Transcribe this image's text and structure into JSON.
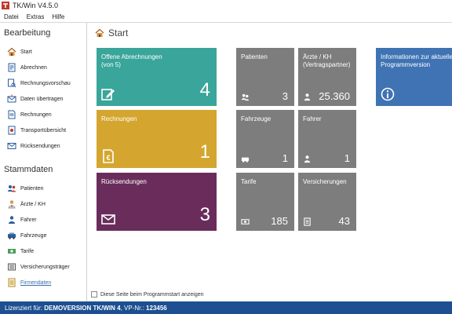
{
  "window": {
    "title": "TK/Win V4.5.0"
  },
  "menu": [
    "Datei",
    "Extras",
    "Hilfe"
  ],
  "sidebar": {
    "section_bearbeitung": "Bearbeitung",
    "bearbeitung_items": [
      {
        "label": "Start",
        "icon": "home-icon"
      },
      {
        "label": "Abrechnen",
        "icon": "invoice-icon"
      },
      {
        "label": "Rechnungsvorschau",
        "icon": "preview-icon"
      },
      {
        "label": "Daten übertragen",
        "icon": "transfer-icon"
      },
      {
        "label": "Rechnungen",
        "icon": "document-icon"
      },
      {
        "label": "Transportübersicht",
        "icon": "overview-icon"
      },
      {
        "label": "Rücksendungen",
        "icon": "mail-icon"
      }
    ],
    "section_stammdaten": "Stammdaten",
    "stammdaten_items": [
      {
        "label": "Patienten",
        "icon": "patients-icon"
      },
      {
        "label": "Ärzte / KH",
        "icon": "doctor-icon"
      },
      {
        "label": "Fahrer",
        "icon": "driver-icon"
      },
      {
        "label": "Fahrzeuge",
        "icon": "vehicle-icon"
      },
      {
        "label": "Tarife",
        "icon": "tariff-icon"
      },
      {
        "label": "Versicherungsträger",
        "icon": "insurance-icon"
      },
      {
        "label": "Firmendaten",
        "icon": "company-icon"
      }
    ]
  },
  "main": {
    "title": "Start",
    "tiles": {
      "offene": {
        "label": "Offene Abrechnungen\n(von 5)",
        "count": "4",
        "color": "#3aa59a"
      },
      "rechnungen": {
        "label": "Rechnungen",
        "count": "1",
        "color": "#d4a62f"
      },
      "ruecksendungen": {
        "label": "Rücksendungen",
        "count": "3",
        "color": "#6a2d5b"
      },
      "patienten": {
        "label": "Patienten",
        "count": "3"
      },
      "aerzte": {
        "label": "Ärzte / KH\n(Vertragspartner)",
        "count": "25.360"
      },
      "fahrzeuge": {
        "label": "Fahrzeuge",
        "count": "1"
      },
      "fahrer": {
        "label": "Fahrer",
        "count": "1"
      },
      "tarife": {
        "label": "Tarife",
        "count": "185"
      },
      "versicherungen": {
        "label": "Versicherungen",
        "count": "43"
      },
      "info": {
        "label": "Informationen zur aktuellen\nProgrammversion",
        "color": "#3f73b3"
      }
    },
    "startup_checkbox": "Diese Seite beim Programmstart anzeigen"
  },
  "status": {
    "prefix": "Lizenziert für: ",
    "license": "DEMOVERSION TK/WIN 4",
    "vp_label": ", VP-Nr.: ",
    "vp_number": "123456"
  }
}
